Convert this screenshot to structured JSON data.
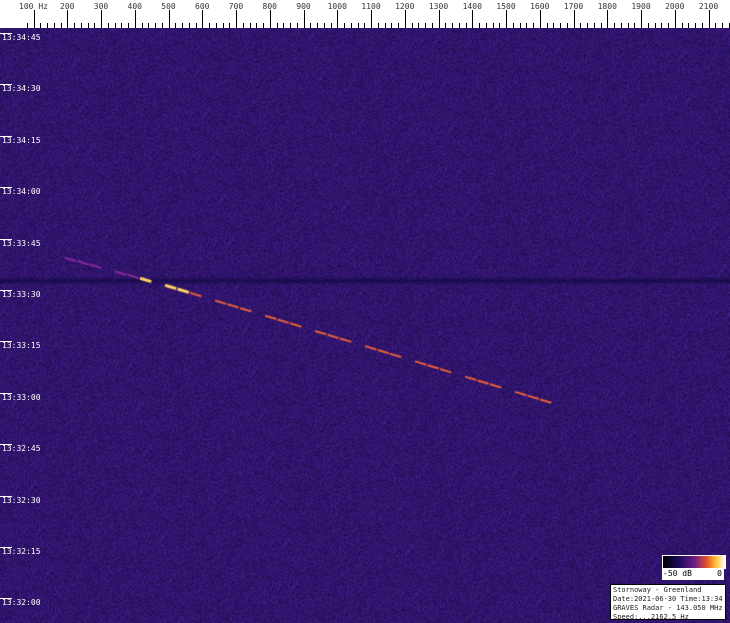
{
  "chart_data": {
    "type": "heatmap",
    "title": "",
    "x_axis": {
      "unit_label": "Hz",
      "range": [
        100,
        2100
      ],
      "tick_labels": [
        "100",
        "200",
        "300",
        "400",
        "500",
        "600",
        "700",
        "800",
        "900",
        "1000",
        "1100",
        "1200",
        "1300",
        "1400",
        "1500",
        "1600",
        "1700",
        "1800",
        "1900",
        "2000",
        "2100"
      ]
    },
    "y_axis": {
      "tick_labels": [
        "13:34:45",
        "13:34:30",
        "13:34:15",
        "13:34:00",
        "13:33:45",
        "13:33:30",
        "13:33:15",
        "13:33:00",
        "13:32:45",
        "13:32:30",
        "13:32:15",
        "13:32:00"
      ],
      "direction": "time decreasing downward"
    },
    "colormap": {
      "min_label": "-50 dB",
      "max_label": "0",
      "colors": [
        "#000000",
        "#1a0a55",
        "#6a1a8a",
        "#e0502a",
        "#ffc030",
        "#ffffff"
      ]
    },
    "background_color": "#1c1478",
    "features": [
      {
        "name": "meteor-trail",
        "points": [
          {
            "hz": 193,
            "time": "13:33:40.6"
          },
          {
            "hz": 475,
            "time": "13:33:33"
          },
          {
            "hz": 1675,
            "time": "13:32:57"
          }
        ],
        "peak_hz": 475
      },
      {
        "name": "dark-band",
        "time": "13:33:34"
      }
    ],
    "grid": false
  },
  "legend": {
    "lines": [
      "Stornoway - Greenland",
      "Date:2021-06-30 Time:13:34",
      "GRAVES Radar - 143.050 MHz",
      "Speed:...2162.5 Hz"
    ]
  }
}
